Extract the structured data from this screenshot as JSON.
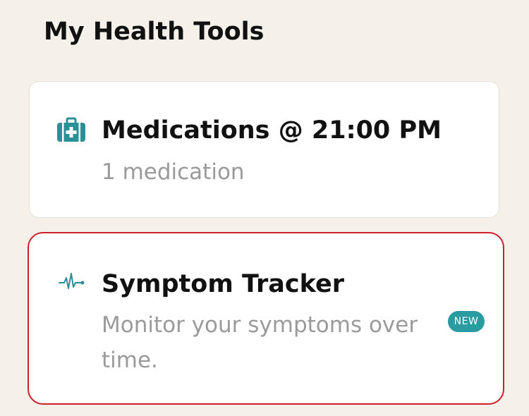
{
  "header": {
    "title": "My Health Tools"
  },
  "cards": {
    "medications": {
      "icon": "medical-kit-icon",
      "title": "Medications @ 21:00 PM",
      "subtitle": "1 medication"
    },
    "symptom_tracker": {
      "icon": "heartbeat-pulse-icon",
      "title": "Symptom Tracker",
      "subtitle": "Monitor your symptoms over time.",
      "badge": "NEW"
    }
  },
  "colors": {
    "background": "#f5f1ea",
    "accent_teal": "#2a9ba0",
    "highlight_border": "#cc1f2b",
    "text_primary": "#111111",
    "text_secondary": "#9a9a9a"
  }
}
